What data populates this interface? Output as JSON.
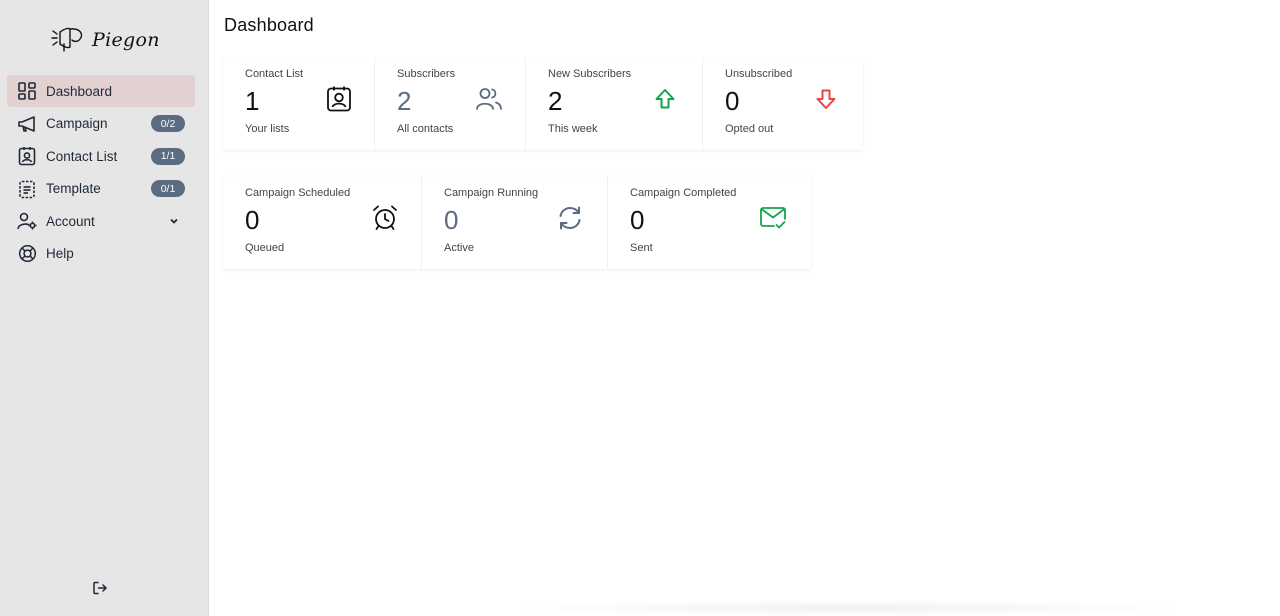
{
  "app": {
    "logo_text": "Piegon"
  },
  "sidebar": {
    "items": [
      {
        "label": "Dashboard",
        "icon": "dashboard-grid-icon",
        "active": true
      },
      {
        "label": "Campaign",
        "icon": "megaphone-icon",
        "badge": "0/2"
      },
      {
        "label": "Contact List",
        "icon": "contact-card-icon",
        "badge": "1/1"
      },
      {
        "label": "Template",
        "icon": "template-document-icon",
        "badge": "0/1"
      },
      {
        "label": "Account",
        "icon": "user-settings-icon",
        "expandable": true
      },
      {
        "label": "Help",
        "icon": "lifebuoy-icon"
      }
    ],
    "logout_icon": "logout-icon"
  },
  "main": {
    "title": "Dashboard",
    "stats_row1": [
      {
        "title": "Contact List",
        "value": "1",
        "sub": "Your lists",
        "icon": "contact-card-icon"
      },
      {
        "title": "Subscribers",
        "value": "2",
        "sub": "All contacts",
        "icon": "users-icon"
      },
      {
        "title": "New Subscribers",
        "value": "2",
        "sub": "This week",
        "icon": "arrow-up-icon"
      },
      {
        "title": "Unsubscribed",
        "value": "0",
        "sub": "Opted out",
        "icon": "arrow-down-icon"
      }
    ],
    "stats_row2": [
      {
        "title": "Campaign Scheduled",
        "value": "0",
        "sub": "Queued",
        "icon": "alarm-clock-icon"
      },
      {
        "title": "Campaign Running",
        "value": "0",
        "sub": "Active",
        "icon": "refresh-icon"
      },
      {
        "title": "Campaign Completed",
        "value": "0",
        "sub": "Sent",
        "icon": "mail-check-icon"
      }
    ]
  },
  "colors": {
    "sidebar_bg": "#e6e6e6",
    "active_item_bg": "#e3d1d1",
    "badge_bg": "#5b6b82",
    "up_green": "#16a34a",
    "down_red": "#ef4444",
    "slate": "#5b6b82"
  }
}
